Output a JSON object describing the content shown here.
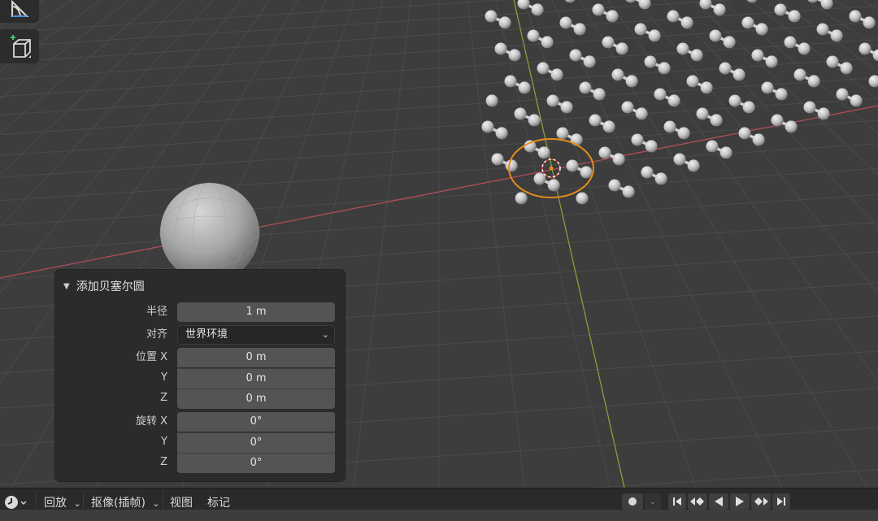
{
  "viewport": {
    "toolbar": {
      "measure_icon": "ruler-measure-icon",
      "add_cube_icon": "add-cube-icon"
    },
    "objects": [
      "sphere",
      "graphene-lattice",
      "bezier-circle"
    ]
  },
  "operator_panel": {
    "title": "添加贝塞尔圆",
    "collapse_icon": "triangle-down-icon",
    "radius": {
      "label": "半径",
      "value": "1 m"
    },
    "align": {
      "label": "对齐",
      "value": "世界环境"
    },
    "location": {
      "label_x": "位置 X",
      "label_y": "Y",
      "label_z": "Z",
      "x": "0 m",
      "y": "0 m",
      "z": "0 m"
    },
    "rotation": {
      "label_x": "旋转 X",
      "label_y": "Y",
      "label_z": "Z",
      "x": "0°",
      "y": "0°",
      "z": "0°"
    }
  },
  "timeline": {
    "editor_icon": "clock-icon",
    "playback_label": "回放",
    "keying_label": "抠像(插帧)",
    "view_label": "视图",
    "marker_label": "标记"
  },
  "colors": {
    "x_axis": "#b34d55",
    "y_axis": "#7ea33a",
    "selection": "#e58b1c",
    "atom": "#c9c9c9"
  }
}
